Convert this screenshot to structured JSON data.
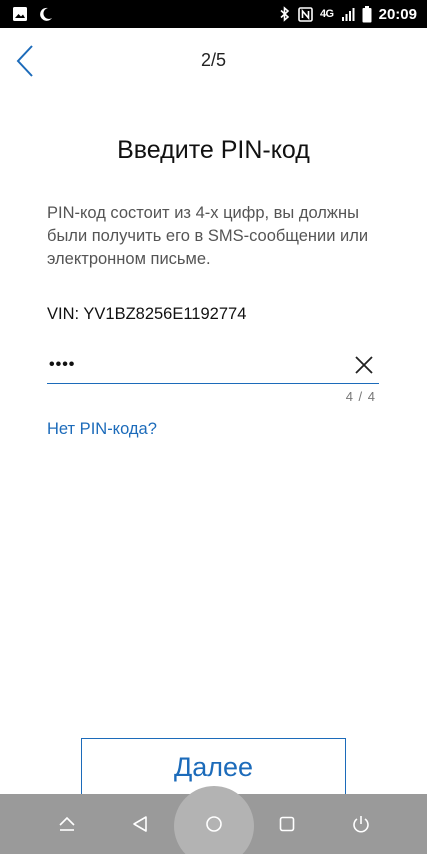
{
  "status_bar": {
    "network": "4G",
    "time": "20:09",
    "icons": [
      "image-icon",
      "moon-icon",
      "bluetooth-icon",
      "nfc-icon",
      "signal-icon",
      "battery-icon"
    ]
  },
  "header": {
    "step": "2/5",
    "back_icon": "chevron-left-icon"
  },
  "title": "Введите PIN-код",
  "description": "PIN-код состоит из 4-х цифр, вы должны были получить его в SMS-сообщении или электронном письме.",
  "vin": "VIN: YV1BZ8256E1192774",
  "pin_input": {
    "value": "••••",
    "counter": "4 / 4",
    "clear_icon": "close-icon"
  },
  "no_pin_link": "Нет PIN-кода?",
  "next_button": "Далее",
  "nav_bar": {
    "icons": [
      "collapse-icon",
      "back-triangle-icon",
      "home-circle-icon",
      "recents-square-icon",
      "power-icon"
    ]
  },
  "colors": {
    "accent": "#1c6bba",
    "status_bar_bg": "#000000",
    "nav_bar_bg": "#9a9a9a"
  }
}
